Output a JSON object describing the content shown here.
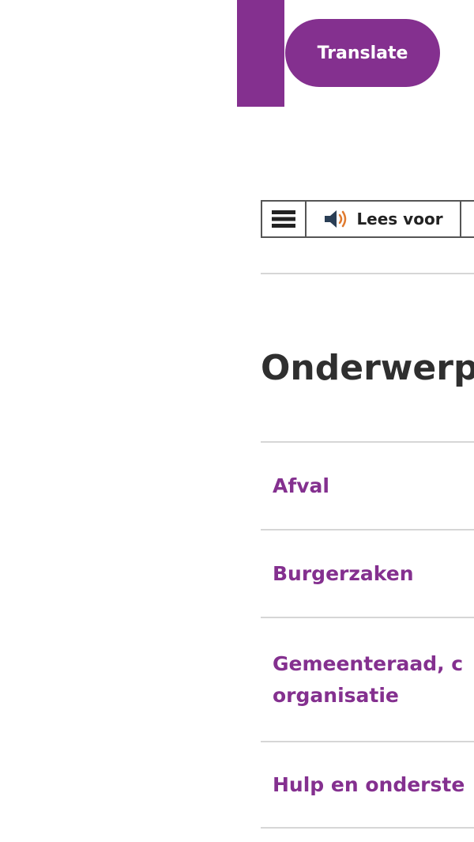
{
  "header": {
    "translate_label": "Translate"
  },
  "toolbar": {
    "menu_icon": "hamburger-menu-icon",
    "read_aloud_icon": "speaker-icon",
    "read_aloud_label": "Lees voor"
  },
  "main": {
    "heading": "Onderwerp",
    "topics": [
      {
        "label": "Afval"
      },
      {
        "label": "Burgerzaken"
      },
      {
        "label_line1": "Gemeenteraad, c",
        "label_line2": "organisatie"
      },
      {
        "label": "Hulp en onderste"
      }
    ]
  },
  "colors": {
    "brand_purple": "#84308f",
    "heading_text": "#2f2f2f",
    "divider": "#d6d6d6"
  }
}
